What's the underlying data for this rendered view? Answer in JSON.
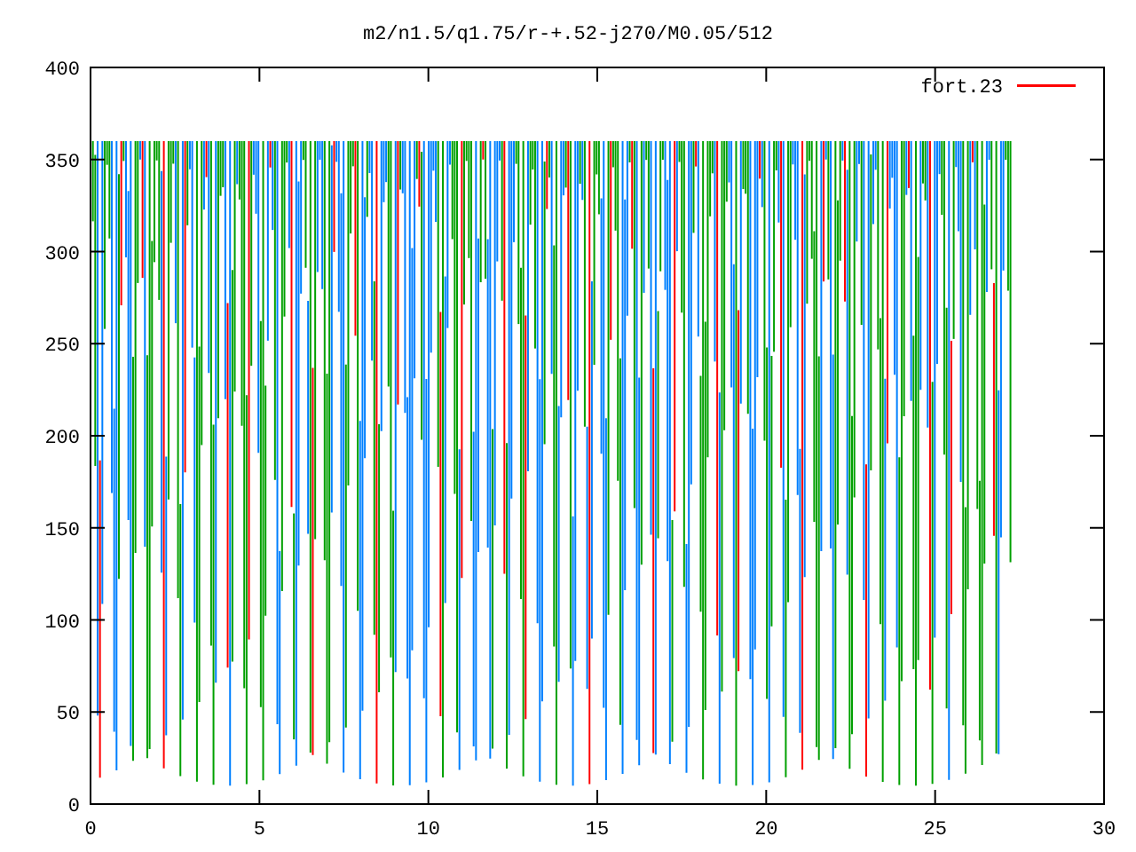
{
  "title": "m2/n1.5/q1.75/r-+.52-j270/M0.05/512",
  "x_axis": {
    "ticks": [
      "0",
      "5",
      "10",
      "15",
      "20",
      "25",
      "30"
    ]
  },
  "y_axis": {
    "ticks": [
      "400",
      "350",
      "300",
      "250",
      "200",
      "150",
      "100",
      "50",
      "0"
    ]
  },
  "legend": [
    {
      "label": "fort.23",
      "color": "#ff0000"
    }
  ]
}
